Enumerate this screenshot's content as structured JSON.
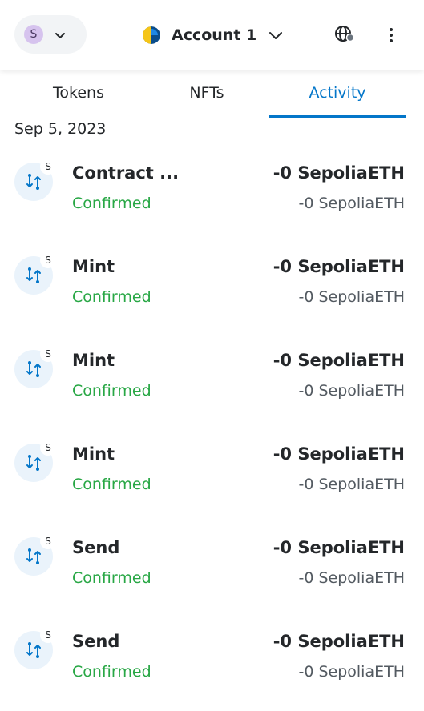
{
  "header": {
    "network_initial": "S",
    "account_name": "Account 1"
  },
  "tabs": [
    {
      "label": "Tokens",
      "active": false
    },
    {
      "label": "NFTs",
      "active": false
    },
    {
      "label": "Activity",
      "active": true
    }
  ],
  "date_label": "Sep 5, 2023",
  "colors": {
    "accent": "#0376c9",
    "confirmed": "#28a745",
    "icon_bg": "#eaf3fb"
  },
  "activities": [
    {
      "icon": "swap-arrows-icon",
      "badge": "S",
      "title": "Contract ...",
      "status": "Confirmed",
      "amount": "-0 SepoliaETH",
      "fiat": "-0 SepoliaETH"
    },
    {
      "icon": "swap-arrows-icon",
      "badge": "S",
      "title": "Mint",
      "status": "Confirmed",
      "amount": "-0 SepoliaETH",
      "fiat": "-0 SepoliaETH"
    },
    {
      "icon": "swap-arrows-icon",
      "badge": "S",
      "title": "Mint",
      "status": "Confirmed",
      "amount": "-0 SepoliaETH",
      "fiat": "-0 SepoliaETH"
    },
    {
      "icon": "swap-arrows-icon",
      "badge": "S",
      "title": "Mint",
      "status": "Confirmed",
      "amount": "-0 SepoliaETH",
      "fiat": "-0 SepoliaETH"
    },
    {
      "icon": "swap-arrows-icon",
      "badge": "S",
      "title": "Send",
      "status": "Confirmed",
      "amount": "-0 SepoliaETH",
      "fiat": "-0 SepoliaETH"
    },
    {
      "icon": "swap-arrows-icon",
      "badge": "S",
      "title": "Send",
      "status": "Confirmed",
      "amount": "-0 SepoliaETH",
      "fiat": "-0 SepoliaETH"
    }
  ]
}
